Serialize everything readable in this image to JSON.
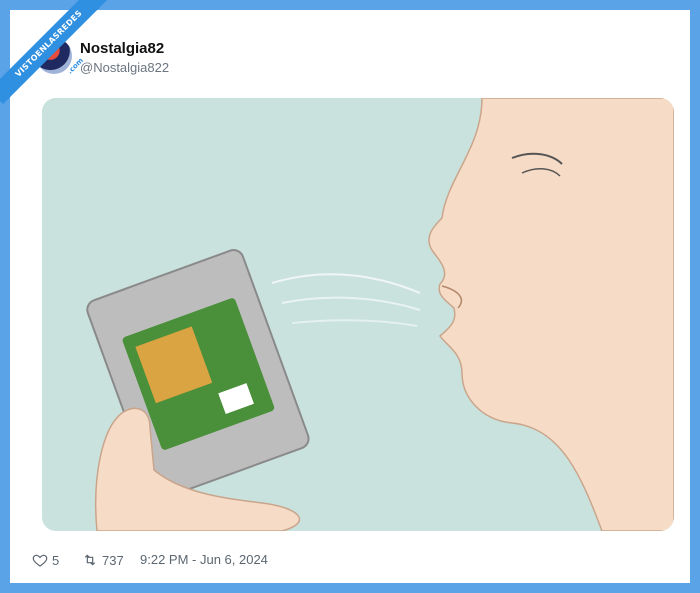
{
  "watermark": {
    "text": "VISTOENLASREDES",
    "sub": ".com"
  },
  "tweet": {
    "author_name": "Nostalgia82",
    "author_handle": "@Nostalgia822",
    "likes": "5",
    "retweets": "737",
    "timestamp": "9:22 PM - Jun 6, 2024"
  },
  "icons": {
    "like": "heart-icon",
    "retweet": "retweet-icon"
  },
  "colors": {
    "background": "#5aa3e6",
    "card": "#ffffff",
    "image_bg": "#c9e2dd"
  }
}
